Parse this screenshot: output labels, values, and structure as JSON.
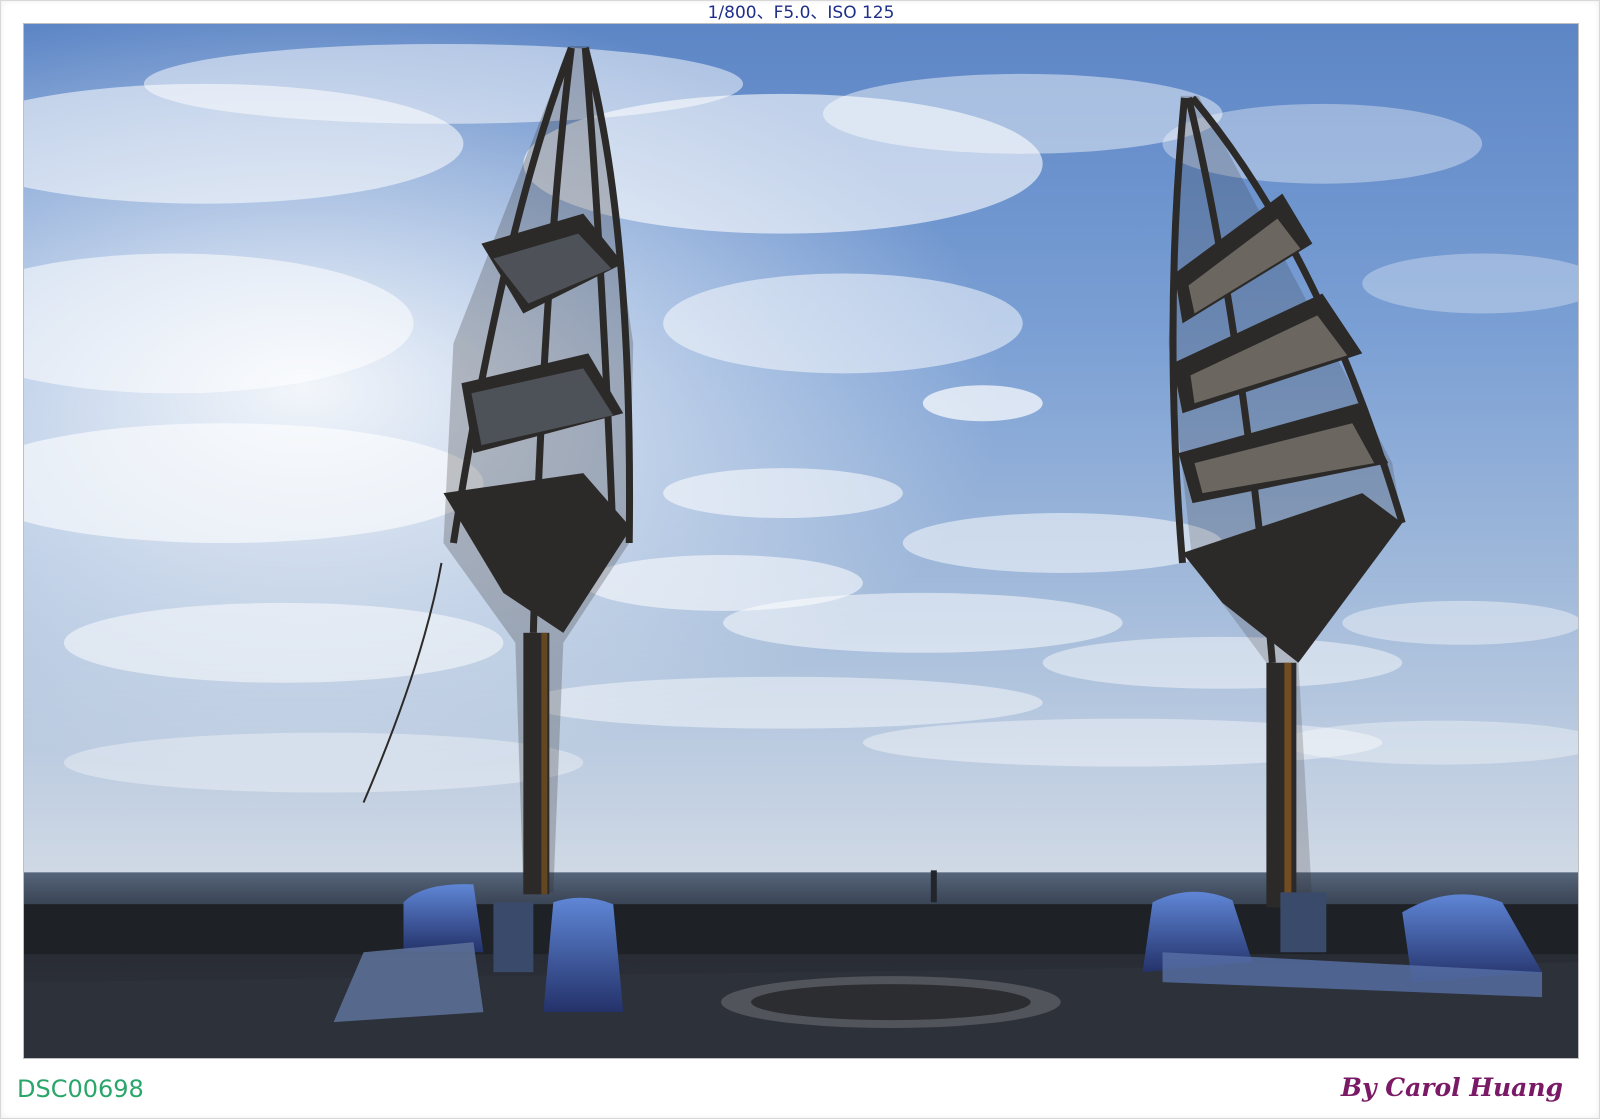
{
  "exif": {
    "text": "1/800、F5.0、ISO 125"
  },
  "photo": {
    "subject": "two sail-shaped lattice sculptures silhouetted against a cloudy sky by the sea"
  },
  "footer": {
    "filename": "DSC00698",
    "credit": "By Carol Huang"
  },
  "colors": {
    "sky_top": "#4f7cc4",
    "sky_mid": "#9eb8dc",
    "horizon": "#cfd8e4",
    "sea": "#3d4b5e",
    "ground": "#2a2e36",
    "silhouette": "#2c2a28",
    "pole_accent": "#8a5a20",
    "base_blue": "#3c63b8",
    "exif_text": "#1e2f8a",
    "filename_text": "#2aa66a",
    "credit_text": "#7a1a66"
  }
}
